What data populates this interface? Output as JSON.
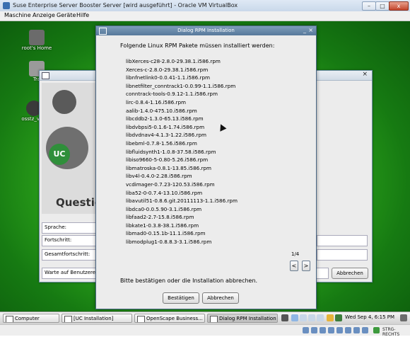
{
  "vbox": {
    "title": "Suse Enterprise Server Booster Server [wird ausgeführt] - Oracle VM VirtualBox",
    "menu": [
      "Maschine",
      "Anzeige",
      "Geräte",
      "Hilfe"
    ],
    "controls": {
      "minimize": "–",
      "maximize": "□",
      "close": "x"
    },
    "host_key": "STRG-RECHTS"
  },
  "desktop": {
    "icons": [
      {
        "label": "root's Home"
      },
      {
        "label": "Tra"
      },
      {
        "label": "osstz_vi_P"
      }
    ]
  },
  "background_window": {
    "question_text": "Question",
    "uc_text": "UC",
    "fields": [
      "Sprache:",
      "Fortschritt:",
      "Gesamtfortschritt:",
      "Warte auf Benutzerei"
    ],
    "abort_label": "Abbrechen",
    "close_glyph": "×"
  },
  "dialog": {
    "title": "Dialog RPM Installation",
    "controls": {
      "minimize": "_",
      "close": "×"
    },
    "heading": "Folgende Linux RPM Pakete müssen installiert werden:",
    "packages": [
      "libXerces-c28-2.8.0-29.38.1.i586.rpm",
      "Xerces-c-2.8.0-29.38.1.i586.rpm",
      "libnfnetlink0-0.0.41-1.1.i586.rpm",
      "libnetfilter_conntrack1-0.0.99-1.1.i586.rpm",
      "conntrack-tools-0.9.12-1.1.i586.rpm",
      "lirc-0.8.4-1.16.i586.rpm",
      "aalib-1.4.0-475.10.i586.rpm",
      "libcddb2-1.3.0-65.13.i586.rpm",
      "libdvbpsi5-0.1.6-1.74.i586.rpm",
      "libdvdnav4-4.1.3-1.22.i586.rpm",
      "libebml-0.7.8-1.56.i586.rpm",
      "libfluidsynth1-1.0.8-37.58.i586.rpm",
      "libiso9660-5-0.80-5.26.i586.rpm",
      "libmatroska-0.8.1-13.85.i586.rpm",
      "libv4l-0.4.0-2.28.i586.rpm",
      "vcdimager-0.7.23-120.53.i586.rpm",
      "liba52-0-0.7.4-13.10.i586.rpm",
      "libavutil51-0.8.6.git.20111113-1.1.i586.rpm",
      "libdca0-0.0.5.90-3.1.i586.rpm",
      "libfaad2-2.7-15.8.i586.rpm",
      "libkate1-0.3.8-38.1.i586.rpm",
      "libmad0-0.15.1b-11.1.i586.rpm",
      "libmodplug1-0.8.8.3-3.1.i586.rpm"
    ],
    "page_indicator": "1/4",
    "prev": "<",
    "next": ">",
    "confirm_text": "Bitte bestätigen oder die Installation abbrechen.",
    "confirm_button": "Bestätigen",
    "cancel_button": "Abbrechen"
  },
  "taskbar": {
    "start": "Computer",
    "tasks": [
      "[UC Installation]",
      "OpenScape Business...",
      "Dialog RPM Installation"
    ],
    "clock": "Wed Sep 4,  6:15 PM"
  },
  "colors": {
    "desktop_green": "#2fa81c",
    "dialog_titlebar": "#56789b",
    "vbox_titlebar": "#c9d8ea"
  }
}
